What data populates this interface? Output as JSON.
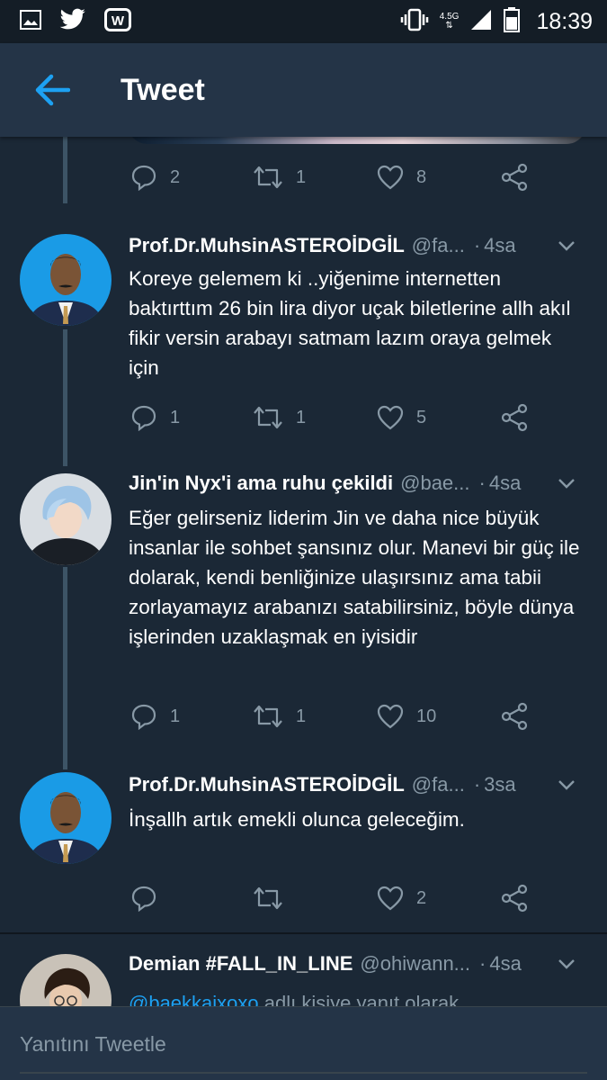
{
  "status_bar": {
    "time": "18:39",
    "network": "4.5G",
    "icons": [
      "gallery-icon",
      "twitter-bird-icon",
      "w-app-icon",
      "vibrate-icon",
      "signal-icon",
      "battery-icon"
    ]
  },
  "app_bar": {
    "title": "Tweet",
    "back_icon": "arrow-left-icon"
  },
  "colors": {
    "background": "#1b2836",
    "header": "#243447",
    "accent": "#1da1f2",
    "muted": "#8899a6"
  },
  "previous_tweet_actions": {
    "replies": "2",
    "retweets": "1",
    "likes": "8"
  },
  "tweets": [
    {
      "name": "Prof.Dr.MuhsinASTEROİDGİL",
      "handle": "@fa...",
      "time": "4sa",
      "text": "Koreye gelemem ki ..yiğenime internetten baktırttım 26 bin lira diyor uçak biletlerine allh akıl fikir versin  arabayı satmam lazım oraya gelmek için",
      "replies": "1",
      "retweets": "1",
      "likes": "5"
    },
    {
      "name": "Jin'in Nyx'i ama ruhu çekildi",
      "handle": "@bae...",
      "time": "4sa",
      "text": "Eğer gelirseniz liderim Jin ve daha nice büyük insanlar ile sohbet şansınız olur. Manevi bir güç ile dolarak, kendi benliğinize ulaşırsınız ama tabii zorlayamayız arabanızı satabilirsiniz, böyle dünya işlerinden uzaklaşmak en iyisidir",
      "replies": "1",
      "retweets": "1",
      "likes": "10"
    },
    {
      "name": "Prof.Dr.MuhsinASTEROİDGİL",
      "handle": "@fa...",
      "time": "3sa",
      "text": "İnşallh artık emekli olunca geleceğim.",
      "replies": "",
      "retweets": "",
      "likes": "2"
    },
    {
      "name": "Demian #FALL_IN_LINE",
      "handle": "@ohiwann...",
      "time": "4sa",
      "reply_mention": "@baekkaixoxo",
      "reply_suffix": " adlı kişiye yanıt olarak"
    }
  ],
  "composer": {
    "placeholder": "Yanıtını Tweetle"
  }
}
